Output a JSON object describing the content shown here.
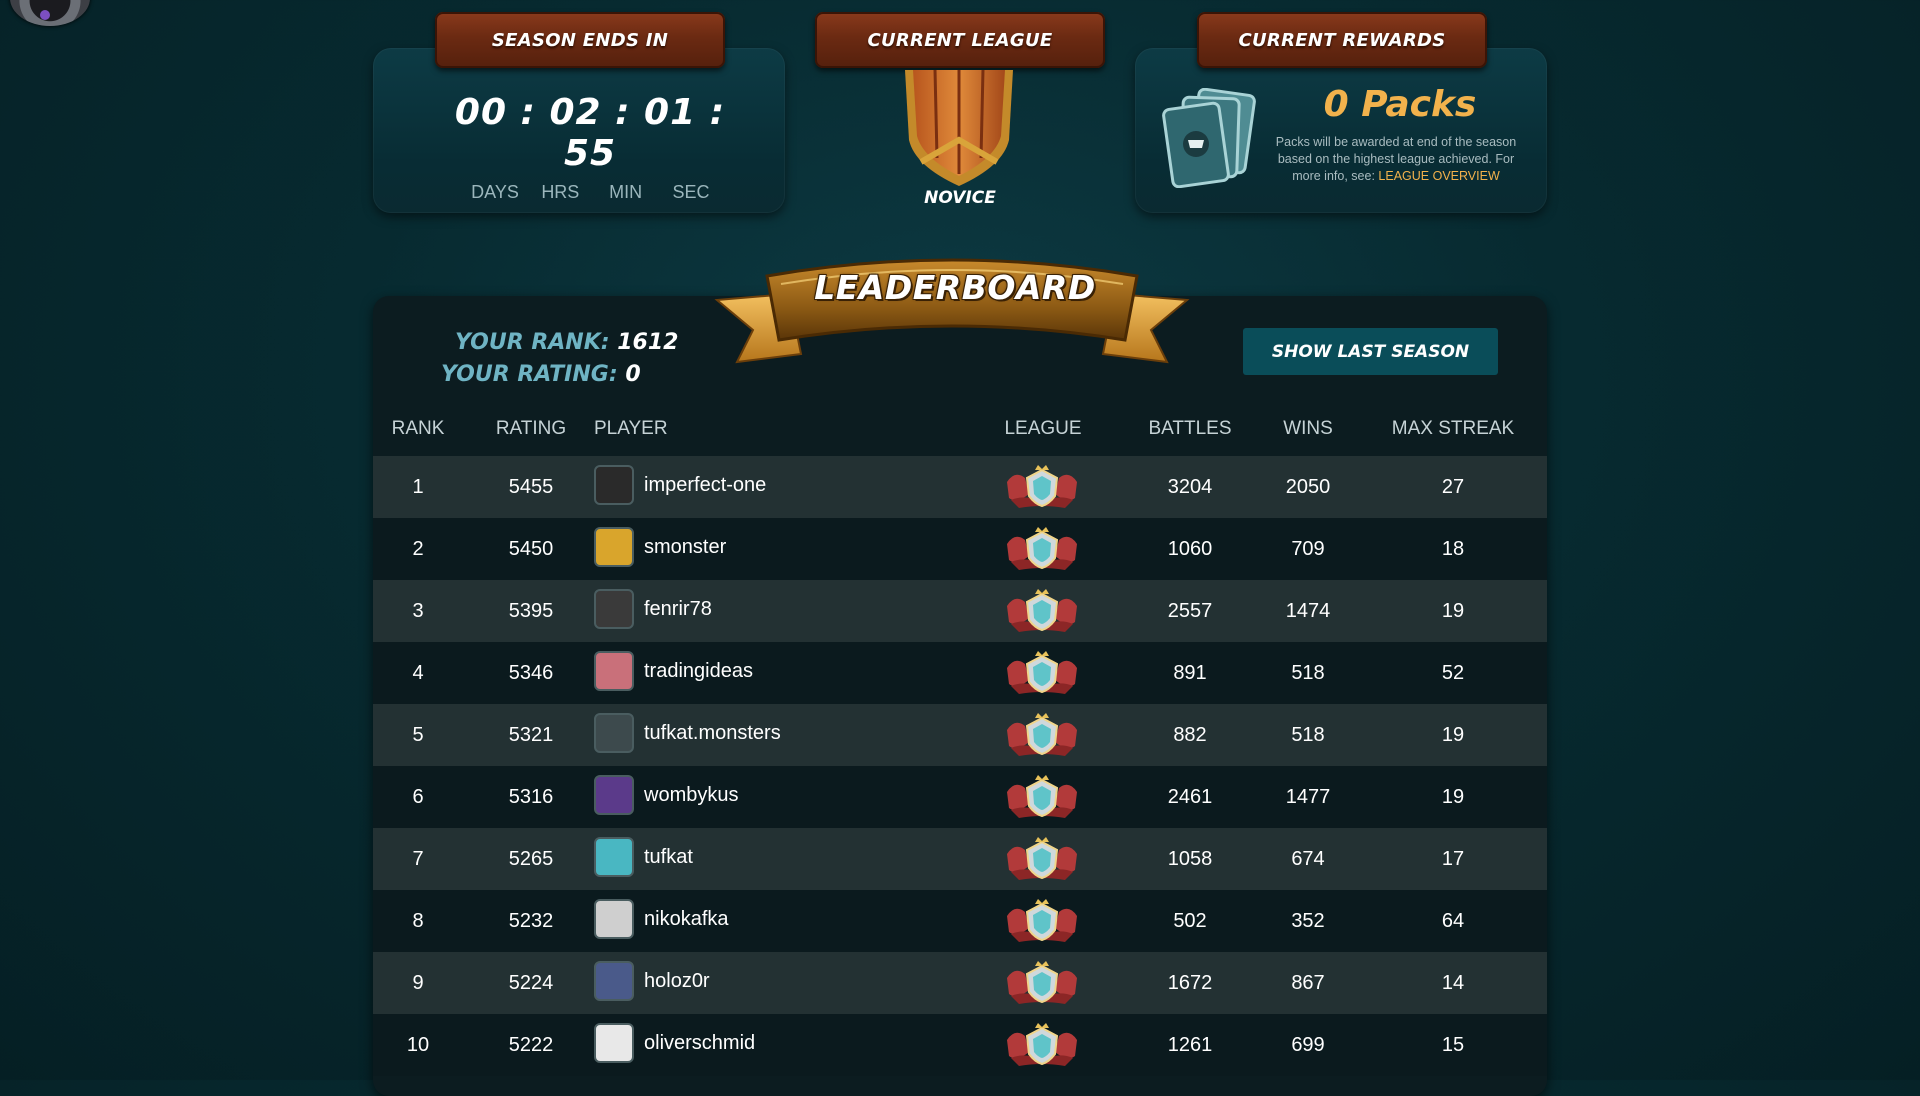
{
  "season": {
    "header": "SEASON ENDS IN",
    "days": "00",
    "hrs": "02",
    "min": "01",
    "sec": "55",
    "labels": {
      "days": "DAYS",
      "hrs": "HRS",
      "min": "MIN",
      "sec": "SEC"
    }
  },
  "league": {
    "header": "CURRENT LEAGUE",
    "name": "NOVICE"
  },
  "rewards": {
    "header": "CURRENT REWARDS",
    "packs": "0 Packs",
    "note": "Packs will be awarded at end of the season based on the highest league achieved. For more info, see:",
    "link": "LEAGUE OVERVIEW"
  },
  "leaderboard": {
    "title": "LEADERBOARD",
    "rank_label": "YOUR RANK:",
    "rank": "1612",
    "rating_label": "YOUR RATING:",
    "rating": "0",
    "show_last_season": "SHOW LAST SEASON",
    "columns": {
      "rank": "RANK",
      "rating": "RATING",
      "player": "PLAYER",
      "league": "LEAGUE",
      "battles": "BATTLES",
      "wins": "WINS",
      "streak": "MAX STREAK"
    },
    "rows": [
      {
        "rank": "1",
        "rating": "5455",
        "player": "imperfect-one",
        "battles": "3204",
        "wins": "2050",
        "streak": "27",
        "avatar": "#2a2a2a"
      },
      {
        "rank": "2",
        "rating": "5450",
        "player": "smonster",
        "battles": "1060",
        "wins": "709",
        "streak": "18",
        "avatar": "#d9a52c"
      },
      {
        "rank": "3",
        "rating": "5395",
        "player": "fenrir78",
        "battles": "2557",
        "wins": "1474",
        "streak": "19",
        "avatar": "#3a3a3a"
      },
      {
        "rank": "4",
        "rating": "5346",
        "player": "tradingideas",
        "battles": "891",
        "wins": "518",
        "streak": "52",
        "avatar": "#c9707a"
      },
      {
        "rank": "5",
        "rating": "5321",
        "player": "tufkat.monsters",
        "battles": "882",
        "wins": "518",
        "streak": "19",
        "avatar": "#3d4a4d"
      },
      {
        "rank": "6",
        "rating": "5316",
        "player": "wombykus",
        "battles": "2461",
        "wins": "1477",
        "streak": "19",
        "avatar": "#5b3a8a"
      },
      {
        "rank": "7",
        "rating": "5265",
        "player": "tufkat",
        "battles": "1058",
        "wins": "674",
        "streak": "17",
        "avatar": "#49b7c2"
      },
      {
        "rank": "8",
        "rating": "5232",
        "player": "nikokafka",
        "battles": "502",
        "wins": "352",
        "streak": "64",
        "avatar": "#cfcfcf"
      },
      {
        "rank": "9",
        "rating": "5224",
        "player": "holoz0r",
        "battles": "1672",
        "wins": "867",
        "streak": "14",
        "avatar": "#4a5a8a"
      },
      {
        "rank": "10",
        "rating": "5222",
        "player": "oliverschmid",
        "battles": "1261",
        "wins": "699",
        "streak": "15",
        "avatar": "#e8e8e8"
      }
    ]
  },
  "icons": {
    "league_badge": "champion-league-icon",
    "pack": "card-pack-icon",
    "shield": "novice-shield-icon"
  },
  "colors": {
    "accent_gold": "#f2b24c",
    "rank_label": "#6fb4c4",
    "button": "#0a4d59"
  }
}
